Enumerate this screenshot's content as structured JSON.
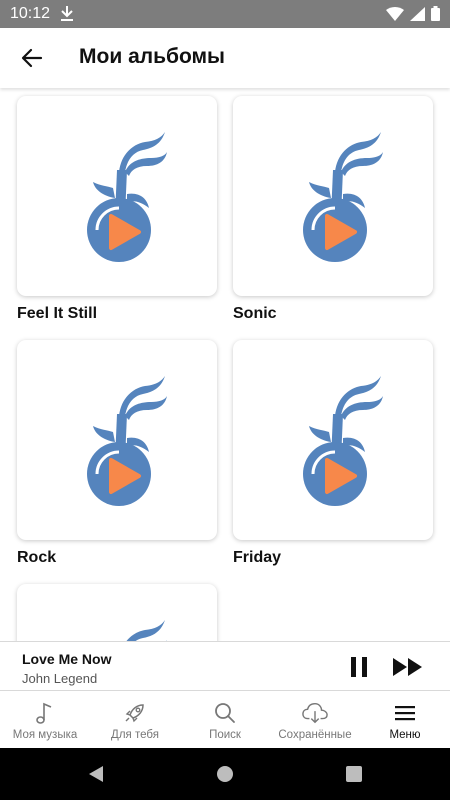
{
  "status_bar": {
    "time": "10:12"
  },
  "app_bar": {
    "title": "Мои альбомы"
  },
  "colors": {
    "logo_blue": "#5584bd",
    "logo_orange": "#f7884a",
    "active_nav": "#111111",
    "inactive_nav": "#777777"
  },
  "albums": [
    {
      "title": "Feel It Still",
      "icon": "music-app-logo"
    },
    {
      "title": "Sonic",
      "icon": "music-app-logo"
    },
    {
      "title": "Rock",
      "icon": "music-app-logo"
    },
    {
      "title": "Friday",
      "icon": "music-app-logo"
    },
    {
      "title": "",
      "icon": "music-app-logo"
    }
  ],
  "player": {
    "title": "Love Me Now",
    "artist": "John Legend",
    "state": "playing"
  },
  "nav": [
    {
      "label": "Моя музыка",
      "icon": "music-note-icon"
    },
    {
      "label": "Для тебя",
      "icon": "rocket-icon"
    },
    {
      "label": "Поиск",
      "icon": "search-icon"
    },
    {
      "label": "Сохранённые",
      "icon": "cloud-download-icon"
    },
    {
      "label": "Меню",
      "icon": "menu-icon",
      "active": true
    }
  ]
}
